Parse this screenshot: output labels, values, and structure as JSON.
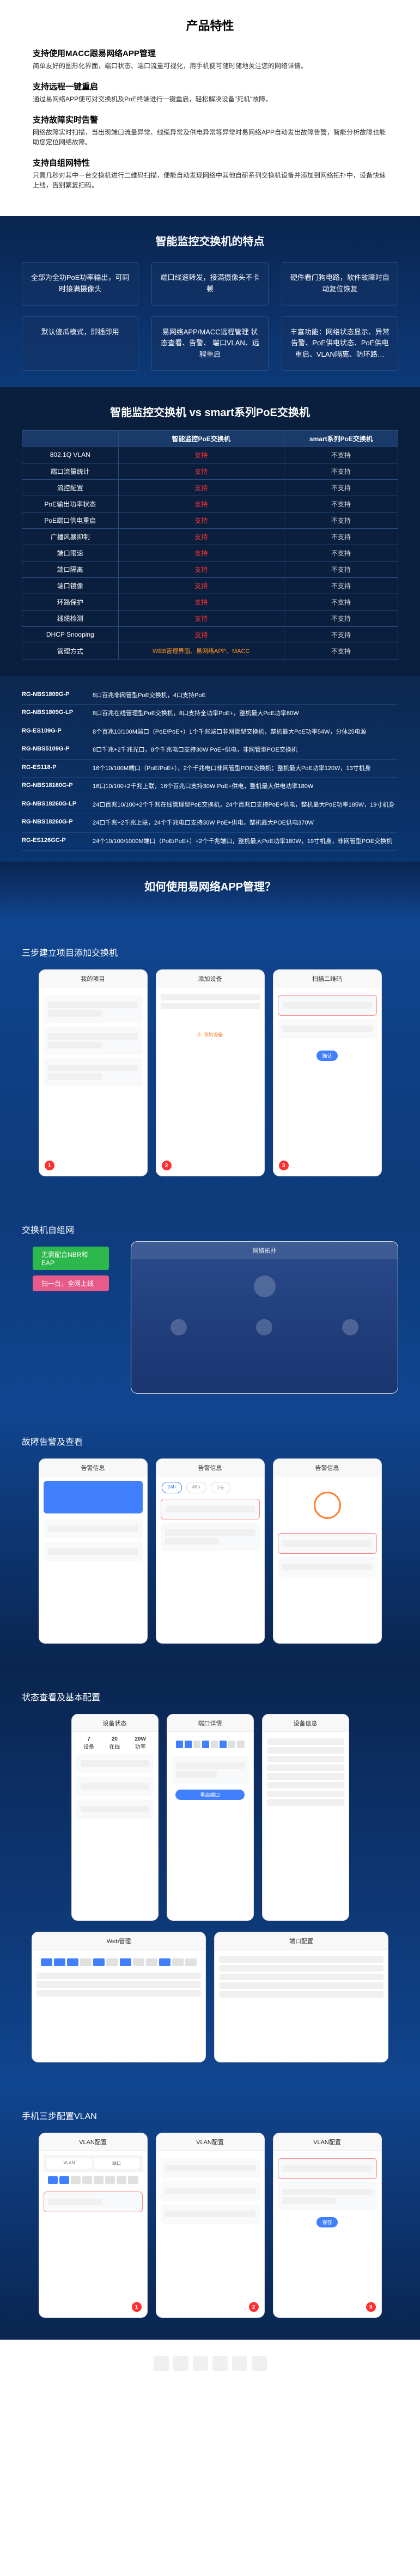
{
  "sections": {
    "product_features": {
      "title": "产品特性",
      "items": [
        {
          "title": "支持使用MACC跟易网络APP管理",
          "desc": "简单友好的图形化界面，端口状态、端口流量可视化，用手机便可随时随地关注您的网络详情。"
        },
        {
          "title": "支持远程一键重启",
          "desc": "通过易网络APP便可对交换机及PoE终端进行一键重启，轻松解决设备\"死机\"故障。"
        },
        {
          "title": "支持故障实时告警",
          "desc": "网络故障实时扫描，当出现端口流量异常、线缆异常及供电异常等异常时易网络APP自动发出故障告警，智能分析故障也能助您定位网络故障。"
        },
        {
          "title": "支持自组网特性",
          "desc": "只需几秒对其中一台交换机进行二维码扫描，便能自动发现网络中其他自研系列交换机设备并添加到网络拓扑中，设备快速上线，告别繁复扫码。"
        }
      ]
    },
    "smart_features": {
      "title": "智能监控交换机的特点",
      "boxes": [
        "全部为全功PoE功率输出，可同时接满摄像头",
        "端口线速转发，接满摄像头不卡顿",
        "硬件看门狗电路，软件故障时自动复位恢复",
        "默认傻瓜模式，即插即用",
        "易网络APP/MACC远程管理\n状态查看、告警、\n端口VLAN、远程重启",
        "丰富功能：网络状态显示、异常告警、PoE供电状态、PoE供电重启、VLAN隔离、防环路…"
      ]
    },
    "comparison": {
      "title": "智能监控交换机 vs smart系列PoE交换机",
      "header": [
        "",
        "智能监控PoE交换机",
        "smart系列PoE交换机"
      ],
      "rows": [
        [
          "802.1Q VLAN",
          "支持",
          "不支持"
        ],
        [
          "端口流量统计",
          "支持",
          "不支持"
        ],
        [
          "流控配置",
          "支持",
          "不支持"
        ],
        [
          "PoE输出功率状态",
          "支持",
          "不支持"
        ],
        [
          "PoE端口供电重启",
          "支持",
          "不支持"
        ],
        [
          "广播风暴抑制",
          "支持",
          "不支持"
        ],
        [
          "端口限速",
          "支持",
          "不支持"
        ],
        [
          "端口隔离",
          "支持",
          "不支持"
        ],
        [
          "端口镜像",
          "支持",
          "不支持"
        ],
        [
          "环路保护",
          "支持",
          "不支持"
        ],
        [
          "线缆检测",
          "支持",
          "不支持"
        ],
        [
          "DHCP Snooping",
          "支持",
          "不支持"
        ],
        [
          "管理方式",
          "WEB管理界面、易网络APP、MACC",
          "不支持"
        ]
      ]
    },
    "specs": {
      "rows": [
        {
          "model": "RG-NBS1809G-P",
          "desc": "8口百兆非网管型PoE交换机，4口支持PoE"
        },
        {
          "model": "RG-NBS1809G-LP",
          "desc": "8口百兆在线管理型PoE交换机，8口支持全功率PoE+，整机最大PoE功率60W"
        },
        {
          "model": "RG-ES109G-P",
          "desc": "8个百兆10/100M端口（PoE/PoE+）1个千兆端口非网管型交换机，整机最大PoE功率54W，分体25电源"
        },
        {
          "model": "RG-NBS5109G-P",
          "desc": "8口千兆+2千兆光口，8个千兆电口支持30W PoE+供电，非网管型POE交换机"
        },
        {
          "model": "RG-ES118-P",
          "desc": "16个10/100M端口（PoE/PoE+），2个千兆电口非网管型POE交换机；整机最大PoE功率120W，13寸机身"
        },
        {
          "model": "RG-NBS18160G-P",
          "desc": "16口10/100+2千兆上联，16个百兆口支持30W PoE+供电，整机最大供电功率180W"
        },
        {
          "model": "RG-NBS18260G-LP",
          "desc": "24口百兆10/100+2个千兆在线管理型PoE交换机，24个百兆口支持PoE+供电，整机最大PoE功率185W，19寸机身"
        },
        {
          "model": "RG-NBS18260G-P",
          "desc": "24口千兆+2千兆上联，24个千兆电口支持30W PoE+供电，整机最大POE供电370W"
        },
        {
          "model": "RG-ES126GC-P",
          "desc": "24个10/100/1000M端口（PoE/PoE+）+2个千兆端口，整机最大PoE功率180W，19寸机身，非网管型POE交换机"
        }
      ]
    },
    "howto": {
      "title": "如何使用易网络APP管理？",
      "step1": "三步建立项目添加交换机",
      "step2": "交换机自组网",
      "step2_tags": [
        "无需配合NBR和EAP",
        "扫一台，全网上线"
      ],
      "step3": "故障告警及查看",
      "step4": "状态查看及基本配置",
      "step5": "手机三步配置VLAN"
    },
    "mock": {
      "header1": "我的项目",
      "header2": "添加设备",
      "header3": "扫描二维码",
      "btn_add": "添加",
      "btn_confirm": "确认",
      "net_title": "网络拓扑",
      "alert_title": "告警信息",
      "status_title": "设备状态",
      "vlan_title": "VLAN配置"
    }
  }
}
